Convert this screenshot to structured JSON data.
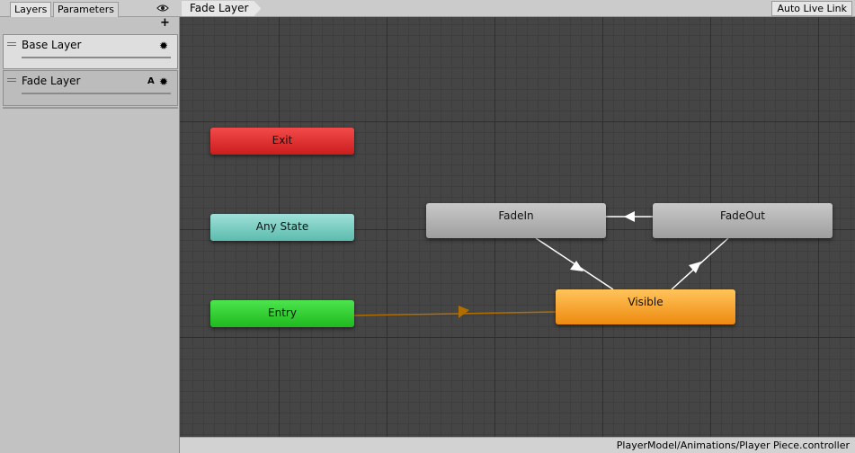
{
  "left_panel": {
    "tabs": [
      {
        "label": "Layers",
        "active": true
      },
      {
        "label": "Parameters",
        "active": false
      }
    ],
    "visibility_icon": "eye-icon",
    "add_label": "+",
    "layers": [
      {
        "name": "Base Layer",
        "selected": false,
        "badge": ""
      },
      {
        "name": "Fade Layer",
        "selected": true,
        "badge": "A"
      }
    ]
  },
  "graph": {
    "breadcrumb": "Fade Layer",
    "auto_live_link": "Auto Live Link",
    "states": {
      "exit": "Exit",
      "any_state": "Any State",
      "entry": "Entry",
      "fade_in": "FadeIn",
      "fade_out": "FadeOut",
      "visible": "Visible"
    },
    "colors": {
      "exit": "#e02a2a",
      "any_state": "#7acfc4",
      "entry": "#32d032",
      "default_state": "#f6a532",
      "state": "#b5b5b5",
      "background": "#454545",
      "transition": "#ffffff",
      "entry_transition": "#b06e00"
    },
    "transitions": [
      {
        "from": "Entry",
        "to": "Visible"
      },
      {
        "from": "FadeOut",
        "to": "FadeIn"
      },
      {
        "from": "FadeIn",
        "to": "Visible"
      },
      {
        "from": "Visible",
        "to": "FadeOut"
      }
    ]
  },
  "status_bar": {
    "asset_path": "PlayerModel/Animations/Player Piece.controller"
  }
}
